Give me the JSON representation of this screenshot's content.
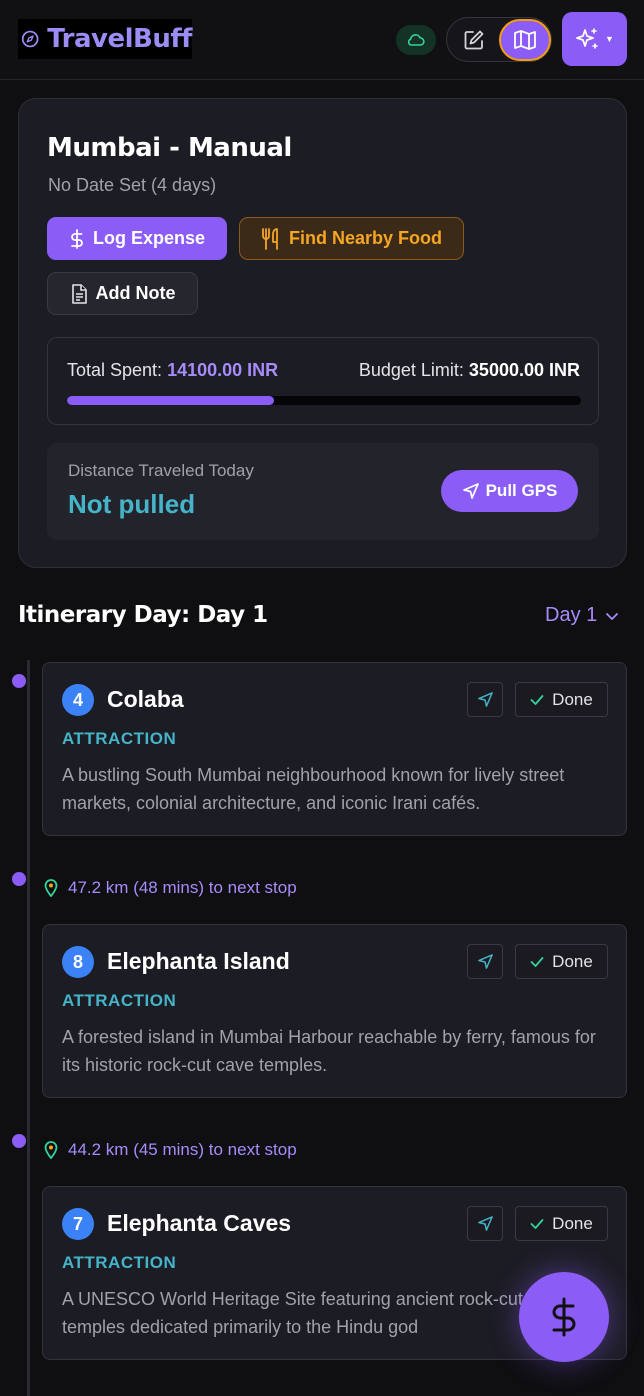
{
  "header": {
    "app_name": "TravelBuff",
    "logo_icon": "compass-icon",
    "cloud_icon": "cloud-icon",
    "edit_icon": "edit-icon",
    "map_icon": "map-icon",
    "ai_icon": "sparkles-icon"
  },
  "trip": {
    "title": "Mumbai - Manual",
    "subtitle": "No Date Set (4 days)",
    "actions": {
      "log_expense": "Log Expense",
      "find_food": "Find Nearby Food",
      "add_note": "Add Note"
    },
    "budget": {
      "spent_label": "Total Spent:",
      "spent_value": "14100.00 INR",
      "limit_label": "Budget Limit:",
      "limit_value": "35000.00 INR",
      "fraction": 0.4029
    },
    "distance": {
      "label": "Distance Traveled Today",
      "value": "Not pulled",
      "button": "Pull GPS"
    }
  },
  "itinerary": {
    "title": "Itinerary Day: Day 1",
    "day_selected": "Day 1",
    "done_label": "Done",
    "stops": [
      {
        "number": "4",
        "name": "Colaba",
        "category": "ATTRACTION",
        "description": "A bustling South Mumbai neighbourhood known for lively street markets, colonial architecture, and iconic Irani cafés."
      },
      {
        "number": "8",
        "name": "Elephanta Island",
        "category": "ATTRACTION",
        "description": "A forested island in Mumbai Harbour reachable by ferry, famous for its historic rock-cut cave temples."
      },
      {
        "number": "7",
        "name": "Elephanta Caves",
        "category": "ATTRACTION",
        "description": "A UNESCO World Heritage Site featuring ancient rock-cut cave temples dedicated primarily to the Hindu god"
      }
    ],
    "travel": [
      "47.2 km (48 mins) to next stop",
      "44.2 km (45 mins) to next stop"
    ]
  },
  "fab": {
    "icon": "dollar-icon"
  },
  "colors": {
    "accent": "#8b5cf6",
    "teal": "#45b3c8",
    "orange": "#f5a524",
    "background": "#0f0f12"
  }
}
